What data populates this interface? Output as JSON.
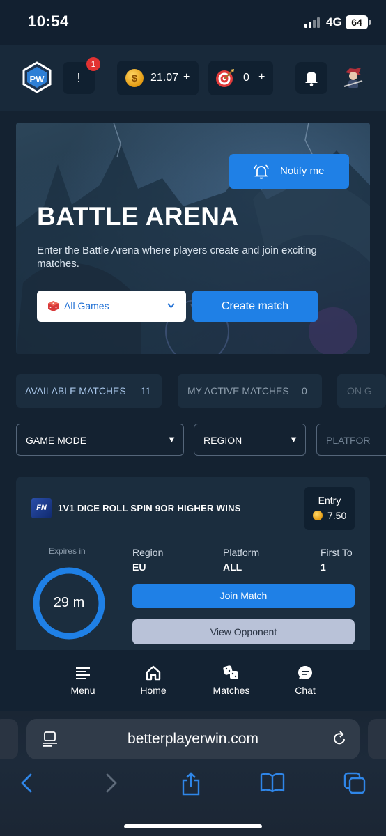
{
  "status_bar": {
    "time": "10:54",
    "network": "4G",
    "battery": "64"
  },
  "header": {
    "logo_text": "BPW",
    "alert_label": "!",
    "alert_badge": "1",
    "coins": "21.07",
    "coins_plus": "+",
    "tickets": "0",
    "tickets_plus": "+",
    "icons": [
      "logo",
      "alert-icon",
      "coin-icon",
      "target-icon",
      "bell-icon",
      "avatar"
    ]
  },
  "hero": {
    "notify_label": "Notify me",
    "title": "BATTLE ARENA",
    "description": "Enter the Battle Arena where players create and join exciting matches.",
    "game_select": "All Games",
    "create_label": "Create match"
  },
  "tabs": [
    {
      "label": "AVAILABLE MATCHES",
      "count": "11"
    },
    {
      "label": "MY ACTIVE MATCHES",
      "count": "0"
    },
    {
      "label": "ON G",
      "count": ""
    }
  ],
  "filters": [
    {
      "label": "GAME MODE",
      "arrow": "▼"
    },
    {
      "label": "REGION",
      "arrow": "▼"
    },
    {
      "label": "PLATFOR",
      "arrow": ""
    }
  ],
  "match": {
    "game_logo": "FN",
    "title": "1V1 DICE ROLL SPIN 9OR HIGHER WINS",
    "entry_label": "Entry",
    "entry_value": "7.50",
    "expires_label": "Expires in",
    "expires_value": "29 m",
    "expires_fraction": 1.0,
    "info": [
      {
        "label": "Region",
        "value": "EU"
      },
      {
        "label": "Platform",
        "value": "ALL"
      },
      {
        "label": "First To",
        "value": "1"
      }
    ],
    "join_label": "Join Match",
    "view_label": "View Opponent"
  },
  "bottom_nav": [
    {
      "label": "Menu",
      "icon": "menu-icon"
    },
    {
      "label": "Home",
      "icon": "home-icon"
    },
    {
      "label": "Matches",
      "icon": "dice-icon"
    },
    {
      "label": "Chat",
      "icon": "chat-icon"
    }
  ],
  "browser": {
    "url": "betterplayerwin.com"
  },
  "colors": {
    "accent": "#1f80e6",
    "background": "#142231",
    "card": "#1b2d3e",
    "badge": "#e23232"
  }
}
